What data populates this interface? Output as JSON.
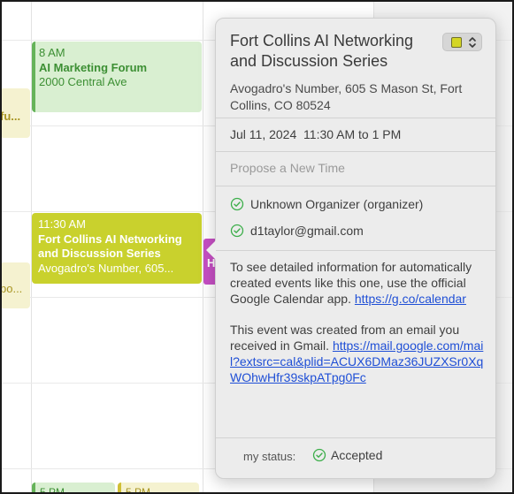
{
  "calendar": {
    "events": {
      "marketing": {
        "time": "8 AM",
        "title": "AI Marketing Forum",
        "location": "2000 Central Ave"
      },
      "forum": {
        "time": "11:30 AM",
        "title": "Fort Collins AI Networking and Discussion Series",
        "location": "Avogadro's Number, 605..."
      },
      "left_a": {
        "text": "fu..."
      },
      "left_b": {
        "text": "po..."
      },
      "purple": {
        "text": "H"
      },
      "bottom_1": {
        "text": "5 PM"
      },
      "bottom_2": {
        "text": "5 PM"
      }
    },
    "colors": {
      "green": "#66b35a",
      "olive": "#c9d12d",
      "purple": "#c64fc4"
    }
  },
  "popover": {
    "title": "Fort Collins AI Networking and Discussion Series",
    "location": "Avogadro's Number, 605 S Mason St, Fort Collins, CO 80524",
    "date": "Jul 11, 2024",
    "time": "11:30 AM to 1 PM",
    "propose": "Propose a New Time",
    "attendees": [
      {
        "text": "Unknown Organizer (organizer)",
        "icon": "check-circle-icon"
      },
      {
        "text": "d1taylor@gmail.com",
        "icon": "check-circle-icon"
      }
    ],
    "desc1": "To see detailed information for automatically created events like this one, use the official Google Calendar app.",
    "link1": "https://g.co/calendar",
    "desc2": "This event was created from an email you received in Gmail.",
    "link2": "https://mail.google.com/mail?extsrc=cal&plid=ACUX6DMaz36JUZXSr0XqWOhwHfr39skpATpg0Fc",
    "status_label": "my status:",
    "status_value": "Accepted",
    "calendar_color": "#d4d625"
  }
}
